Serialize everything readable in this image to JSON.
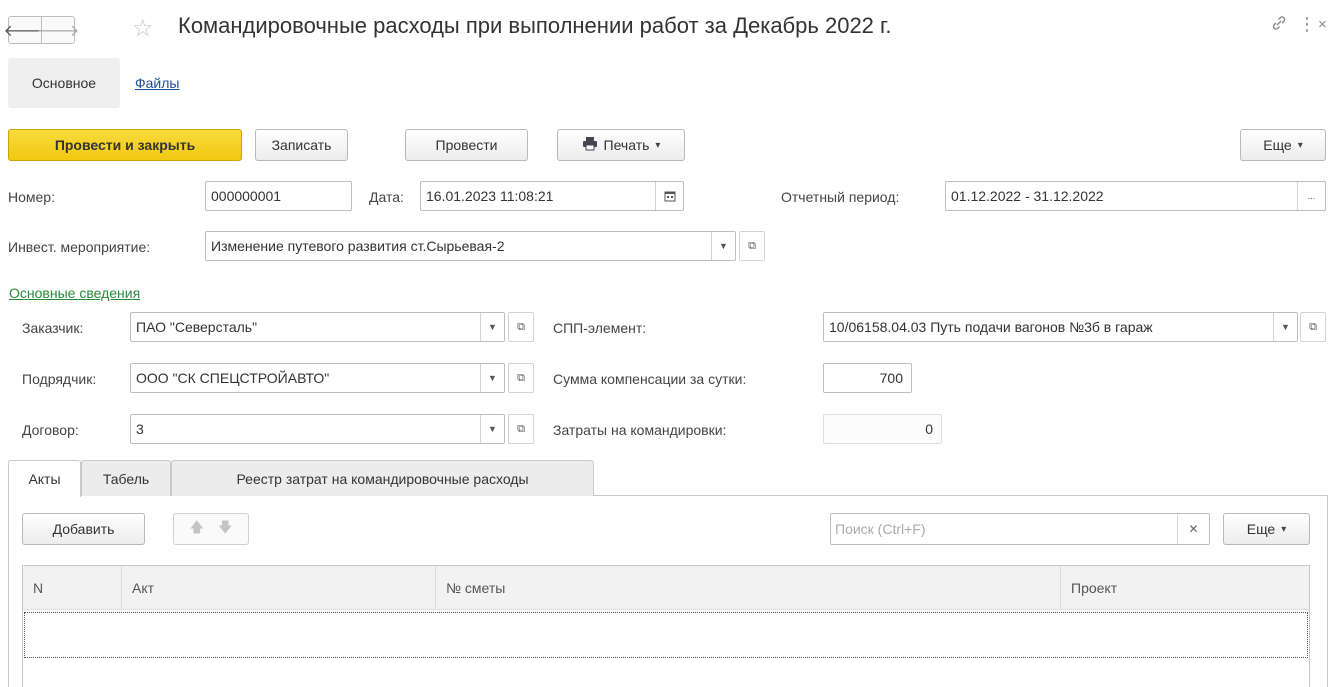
{
  "window": {
    "title": "Командировочные расходы при выполнении работ за Декабрь 2022 г.",
    "back_icon": "arrow-left-icon",
    "forward_icon": "arrow-right-icon",
    "favorite_icon": "star-icon",
    "link_icon": "link-icon",
    "more_icon": "more-vertical-icon",
    "close_icon": "close-icon"
  },
  "top_tabs": [
    {
      "label": "Основное",
      "active": true
    },
    {
      "label": "Файлы",
      "active": false
    }
  ],
  "toolbar": {
    "post_close": "Провести и закрыть",
    "save": "Записать",
    "post": "Провести",
    "print": "Печать",
    "more": "Еще"
  },
  "header": {
    "number_label": "Номер:",
    "number_value": "000000001",
    "date_label": "Дата:",
    "date_value": "16.01.2023 11:08:21",
    "period_label": "Отчетный период:",
    "period_value": "01.12.2022 - 31.12.2022",
    "invest_label": "Инвест. мероприятие:",
    "invest_value": "Изменение путевого развития ст.Сырьевая-2"
  },
  "main_info": {
    "section_title": "Основные сведения",
    "customer_label": "Заказчик:",
    "customer_value": "ПАО \"Северсталь\"",
    "contractor_label": "Подрядчик:",
    "contractor_value": "ООО \"СК СПЕЦСТРОЙАВТО\"",
    "contract_label": "Договор:",
    "contract_value": "3",
    "spp_label": "СПП-элемент:",
    "spp_value": "10/06158.04.03 Путь подачи вагонов №3б в гараж",
    "daily_comp_label": "Сумма компенсации за сутки:",
    "daily_comp_value": "700",
    "travel_costs_label": "Затраты на командировки:",
    "travel_costs_value": "0"
  },
  "bottom_tabs": [
    {
      "label": "Акты",
      "active": true
    },
    {
      "label": "Табель",
      "active": false
    },
    {
      "label": "Реестр затрат на командировочные расходы",
      "active": false
    }
  ],
  "table_toolbar": {
    "add": "Добавить",
    "search_placeholder": "Поиск (Ctrl+F)",
    "more": "Еще"
  },
  "table": {
    "columns": [
      "N",
      "Акт",
      "№ сметы",
      "Проект"
    ],
    "rows": []
  },
  "colors": {
    "primary_button": "#f2c811",
    "link": "#1a4f9c",
    "section_link": "#2a8a3a"
  }
}
